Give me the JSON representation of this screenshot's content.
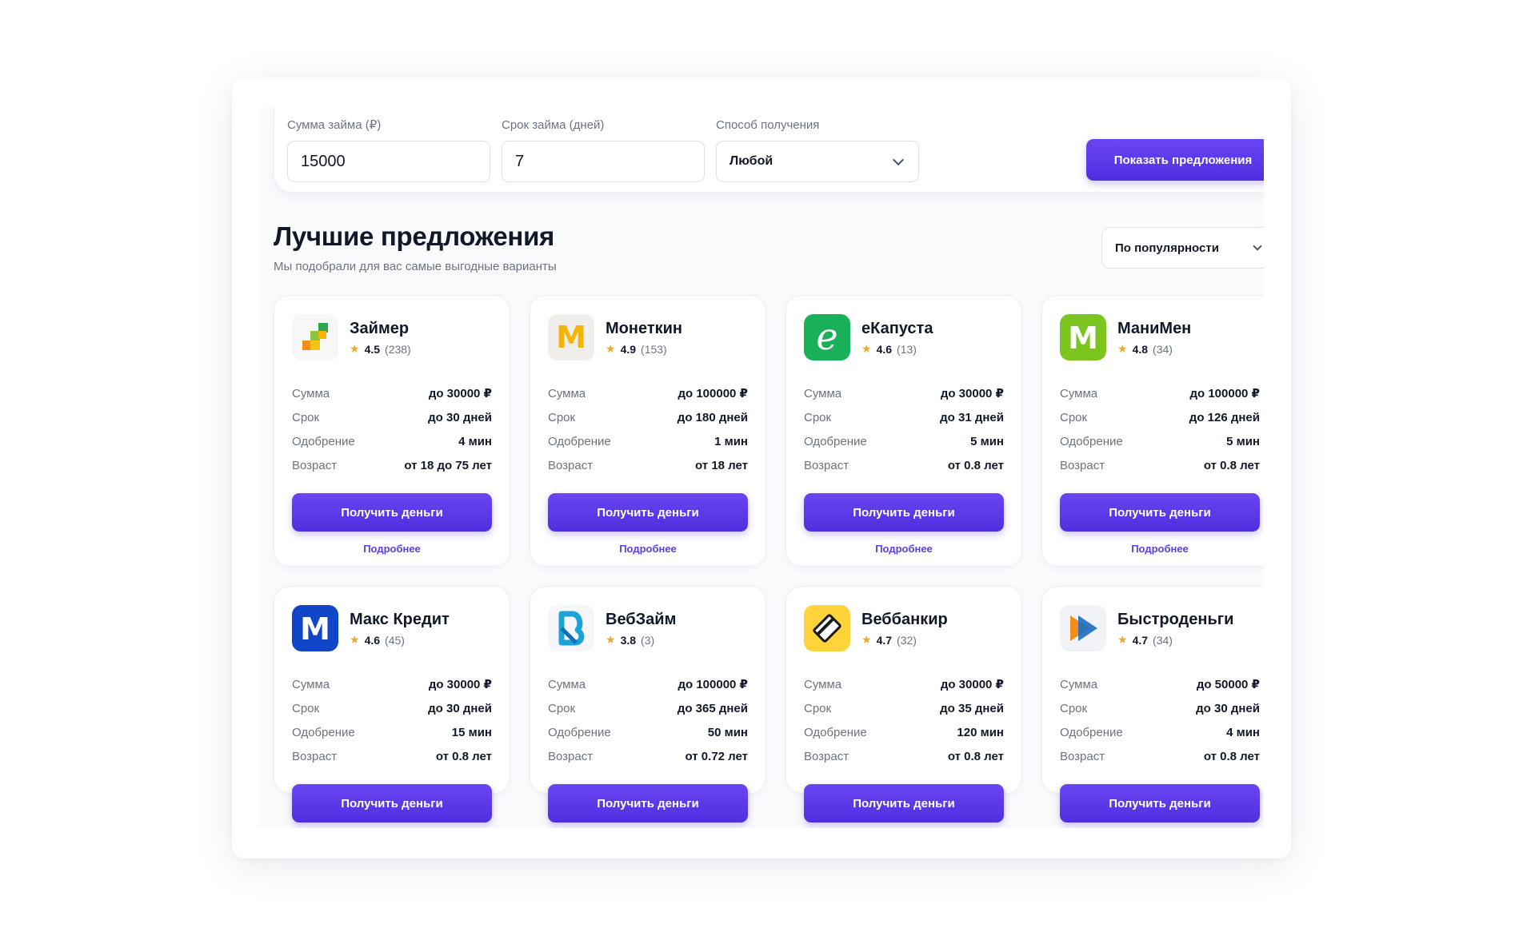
{
  "filter": {
    "amount_label": "Сумма займа (₽)",
    "amount_value": "15000",
    "term_label": "Срок займа (дней)",
    "term_value": "7",
    "method_label": "Способ получения",
    "method_value": "Любой",
    "submit_label": "Показать предложения"
  },
  "offers_section": {
    "title": "Лучшие предложения",
    "subtitle": "Мы подобрали для вас самые выгодные варианты",
    "sort_value": "По популярности"
  },
  "labels": {
    "sum": "Сумма",
    "term": "Срок",
    "approval": "Одобрение",
    "age": "Возраст",
    "get_money": "Получить деньги",
    "more": "Подробнее"
  },
  "offers": [
    {
      "name": "Займер",
      "rating": "4.5",
      "reviews": "(238)",
      "sum": "до 30000 ₽",
      "term": "до 30 дней",
      "approval": "4 мин",
      "age": "от 18 до 75 лет",
      "logo": "zaymer-logo",
      "color": "#f7f7f7"
    },
    {
      "name": "Монеткин",
      "rating": "4.9",
      "reviews": "(153)",
      "sum": "до 100000 ₽",
      "term": "до 180 дней",
      "approval": "1 мин",
      "age": "от 18 лет",
      "logo": "monetkin-logo",
      "color": "#f0eeea"
    },
    {
      "name": "еКапуста",
      "rating": "4.6",
      "reviews": "(13)",
      "sum": "до 30000 ₽",
      "term": "до 31 дней",
      "approval": "5 мин",
      "age": "от 0.8 лет",
      "logo": "ekapusta-logo",
      "color": "#18b15a"
    },
    {
      "name": "МаниМен",
      "rating": "4.8",
      "reviews": "(34)",
      "sum": "до 100000 ₽",
      "term": "до 126 дней",
      "approval": "5 мин",
      "age": "от 0.8 лет",
      "logo": "moneyman-logo",
      "color": "#7cc41f"
    },
    {
      "name": "Макс Кредит",
      "rating": "4.6",
      "reviews": "(45)",
      "sum": "до 30000 ₽",
      "term": "до 30 дней",
      "approval": "15 мин",
      "age": "от 0.8 лет",
      "logo": "maxcredit-logo",
      "color": "#1246c8"
    },
    {
      "name": "ВебЗайм",
      "rating": "3.8",
      "reviews": "(3)",
      "sum": "до 100000 ₽",
      "term": "до 365 дней",
      "approval": "50 мин",
      "age": "от 0.72 лет",
      "logo": "webzaim-logo",
      "color": "#f4f6f9"
    },
    {
      "name": "Веббанкир",
      "rating": "4.7",
      "reviews": "(32)",
      "sum": "до 30000 ₽",
      "term": "до 35 дней",
      "approval": "120 мин",
      "age": "от 0.8 лет",
      "logo": "webbankir-logo",
      "color": "#ffd43b"
    },
    {
      "name": "Быстроденьги",
      "rating": "4.7",
      "reviews": "(34)",
      "sum": "до 50000 ₽",
      "term": "до 30 дней",
      "approval": "4 мин",
      "age": "от 0.8 лет",
      "logo": "bystrodengi-logo",
      "color": "#f1f3f6"
    }
  ]
}
